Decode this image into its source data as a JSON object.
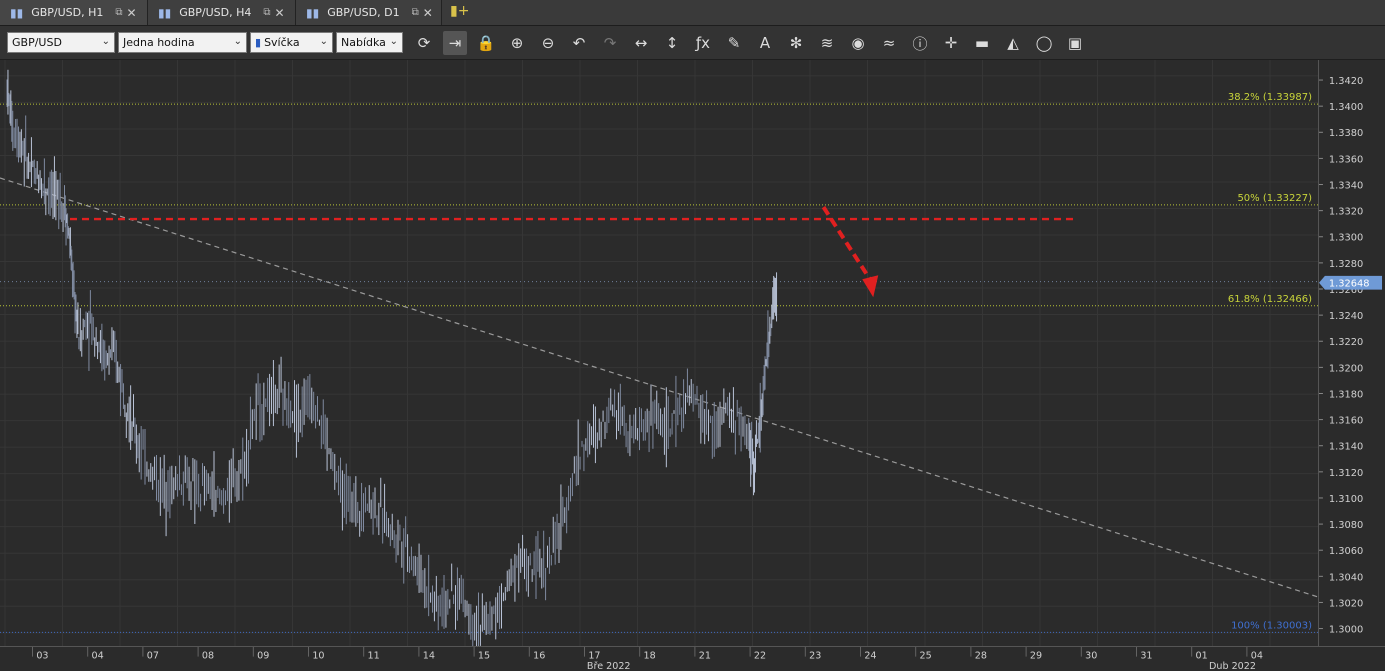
{
  "tabs": [
    {
      "label": "GBP/USD, H1",
      "icon": "candlestick-icon"
    },
    {
      "label": "GBP/USD, H4",
      "icon": "candlestick-icon"
    },
    {
      "label": "GBP/USD, D1",
      "icon": "candlestick-icon"
    }
  ],
  "toolbar": {
    "instrument": "GBP/USD",
    "period": "Jedna hodina",
    "chart_type": "Svíčka",
    "offer_side": "Nabídka",
    "icons": [
      "refresh-icon",
      "shift-chart-icon",
      "lock-icon",
      "zoom-in-icon",
      "zoom-out-icon",
      "undo-icon",
      "redo-icon",
      "horizontal-fit-icon",
      "vertical-fit-icon",
      "indicators-fx-icon",
      "drawing-pen-icon",
      "text-tool-icon",
      "crosshair-tools-icon",
      "layers-icon",
      "visibility-eye-icon",
      "pattern-icon",
      "info-icon",
      "cross-cursor-icon",
      "color-palette-icon",
      "fill-bucket-icon",
      "circle-tool-icon",
      "save-icon"
    ]
  },
  "chart_data": {
    "type": "candlestick",
    "instrument": "GBP/USD",
    "ylim": [
      1.299,
      1.3432
    ],
    "y_ticks": [
      "1.3420",
      "1.3400",
      "1.3380",
      "1.3360",
      "1.3340",
      "1.3320",
      "1.3300",
      "1.3280",
      "1.3260",
      "1.3240",
      "1.3220",
      "1.3200",
      "1.3180",
      "1.3160",
      "1.3140",
      "1.3120",
      "1.3100",
      "1.3080",
      "1.3060",
      "1.3040",
      "1.3020",
      "1.3000"
    ],
    "current_price_label": "1.32648",
    "current_price": 1.32648,
    "fib_levels": [
      {
        "label": "38.2% (1.33987)",
        "value": 1.33987,
        "color": "#c8d43a"
      },
      {
        "label": "50% (1.33227)",
        "value": 1.33227,
        "color": "#c8d43a"
      },
      {
        "label": "61.8% (1.32466)",
        "value": 1.32466,
        "color": "#c8d43a"
      },
      {
        "label": "100% (1.30003)",
        "value": 1.30003,
        "color": "#3f6fd0"
      }
    ],
    "resistance_line": {
      "value": 1.3312,
      "color": "#e02020"
    },
    "arrow_annotation": {
      "from": {
        "date_index": 13.4,
        "price": 1.3318
      },
      "to": {
        "date_index": 14.3,
        "price": 1.325
      },
      "color": "#e02020"
    },
    "trend_line": {
      "from": {
        "date_index": 0,
        "price": 1.3343
      },
      "to": {
        "date_index": 22.6,
        "price": 1.3027
      },
      "color": "#9a9a9a"
    },
    "date_labels": [
      "03",
      "04",
      "07",
      "08",
      "09",
      "10",
      "11",
      "14",
      "15",
      "16",
      "17",
      "18",
      "21",
      "22",
      "23",
      "24",
      "25",
      "28",
      "29",
      "30",
      "31",
      "01",
      "04"
    ],
    "month_labels": [
      {
        "label": "Bře 2022",
        "at_index": 10.3
      },
      {
        "label": "Dub 2022",
        "at_index": 21.6
      }
    ],
    "price_path": [
      [
        0,
        1.3412
      ],
      [
        0.1,
        1.338
      ],
      [
        0.25,
        1.337
      ],
      [
        0.4,
        1.335
      ],
      [
        0.55,
        1.3342
      ],
      [
        0.7,
        1.3336
      ],
      [
        0.85,
        1.333
      ],
      [
        1.0,
        1.3322
      ],
      [
        1.08,
        1.33
      ],
      [
        1.15,
        1.3262
      ],
      [
        1.25,
        1.3222
      ],
      [
        1.4,
        1.3235
      ],
      [
        1.55,
        1.3225
      ],
      [
        1.7,
        1.3205
      ],
      [
        1.85,
        1.321
      ],
      [
        2.0,
        1.319
      ],
      [
        2.15,
        1.316
      ],
      [
        2.3,
        1.314
      ],
      [
        2.5,
        1.3122
      ],
      [
        2.7,
        1.311
      ],
      [
        2.9,
        1.3112
      ],
      [
        3.1,
        1.3118
      ],
      [
        3.3,
        1.3105
      ],
      [
        3.5,
        1.311
      ],
      [
        3.7,
        1.31
      ],
      [
        3.9,
        1.311
      ],
      [
        4.1,
        1.3125
      ],
      [
        4.3,
        1.3165
      ],
      [
        4.5,
        1.3175
      ],
      [
        4.7,
        1.318
      ],
      [
        4.9,
        1.317
      ],
      [
        5.1,
        1.3165
      ],
      [
        5.3,
        1.3178
      ],
      [
        5.5,
        1.3155
      ],
      [
        5.7,
        1.312
      ],
      [
        5.9,
        1.31
      ],
      [
        6.1,
        1.3095
      ],
      [
        6.3,
        1.31
      ],
      [
        6.5,
        1.3088
      ],
      [
        6.7,
        1.3078
      ],
      [
        6.9,
        1.307
      ],
      [
        7.1,
        1.305
      ],
      [
        7.3,
        1.3035
      ],
      [
        7.5,
        1.302
      ],
      [
        7.7,
        1.3025
      ],
      [
        7.9,
        1.303
      ],
      [
        8.1,
        1.301
      ],
      [
        8.3,
        1.3005
      ],
      [
        8.5,
        1.3015
      ],
      [
        8.7,
        1.3035
      ],
      [
        8.9,
        1.306
      ],
      [
        9.1,
        1.3045
      ],
      [
        9.3,
        1.305
      ],
      [
        9.5,
        1.306
      ],
      [
        9.7,
        1.309
      ],
      [
        9.9,
        1.313
      ],
      [
        10.1,
        1.3145
      ],
      [
        10.3,
        1.315
      ],
      [
        10.5,
        1.3175
      ],
      [
        10.7,
        1.3165
      ],
      [
        10.9,
        1.315
      ],
      [
        11.1,
        1.3158
      ],
      [
        11.3,
        1.3165
      ],
      [
        11.5,
        1.315
      ],
      [
        11.7,
        1.317
      ],
      [
        11.9,
        1.3178
      ],
      [
        12.1,
        1.3165
      ],
      [
        12.3,
        1.315
      ],
      [
        12.5,
        1.317
      ],
      [
        12.7,
        1.316
      ],
      [
        12.9,
        1.3145
      ],
      [
        13.0,
        1.313
      ],
      [
        13.1,
        1.316
      ],
      [
        13.2,
        1.32
      ],
      [
        13.3,
        1.324
      ],
      [
        13.4,
        1.3265
      ]
    ]
  },
  "colors": {
    "background": "#2b2b2b",
    "grid": "#3a3a3a",
    "candle_up": "#b8c2d6",
    "candle_down": "#7f8aa0",
    "price_badge": "#6f9ad6"
  }
}
